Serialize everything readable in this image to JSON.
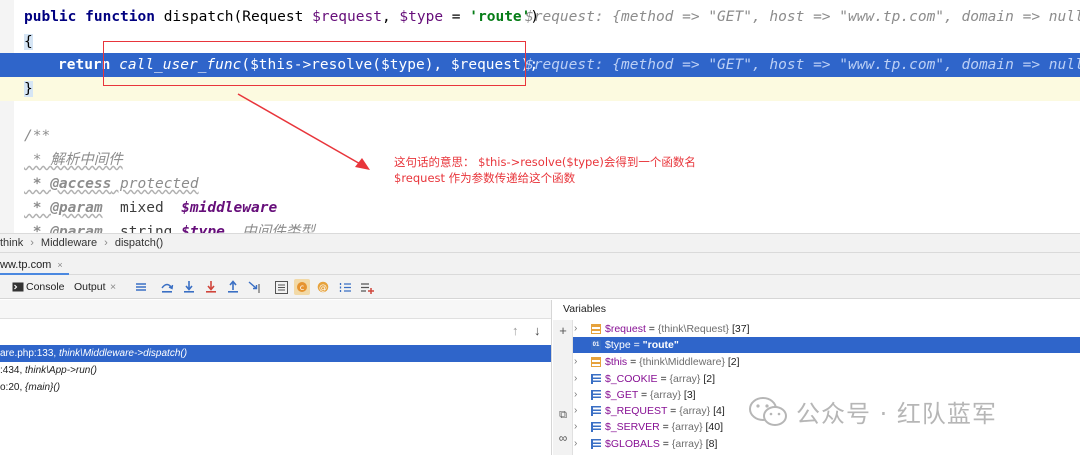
{
  "editor": {
    "line1": {
      "kw1": "public",
      "kw2": "function",
      "name": " dispatch(Request ",
      "param1": "$request",
      "sep": ", ",
      "param2": "$type",
      "eq": " = ",
      "default": "'route'",
      "close": ")",
      "hint": "$request: {method => \"GET\", host => \"www.tp.com\", domain => null, su"
    },
    "line2": {
      "brace": "{"
    },
    "line3": {
      "kw": "return",
      "fn": "call_user_func",
      "args_a": "($this->resolve(",
      "args_var": "$type",
      "args_b": "), ",
      "args_var2": "$request",
      "args_c": ");",
      "hint": "$request: {method => \"GET\", host => \"www.tp.com\", domain => null, su"
    },
    "line4": {
      "brace": "}"
    },
    "doc": {
      "open": "/**",
      "desc": " * 解析中间件",
      "access_tag": " * @access",
      "access_val": " protected",
      "param_tag": " * @param",
      "param_type": "  mixed  ",
      "param_var": "$middleware",
      "param2_tag": " * @param",
      "param2_type": "  string ",
      "param2_var": "$type",
      "param2_desc": "  中间件类型"
    },
    "annotation_line1": "这句话的意思：  $this->resolve($type)会得到一个函数名",
    "annotation_line2": "$request 作为参数传递给这个函数"
  },
  "breadcrumb": [
    "think",
    "Middleware",
    "dispatch()"
  ],
  "debug_session": {
    "label": "ww.tp.com",
    "close": "×"
  },
  "toolbar": {
    "console_label": "Console",
    "output_label": "Output",
    "output_close": "×"
  },
  "frames": [
    {
      "loc": "are.php:133, ",
      "method": "think\\Middleware->dispatch()"
    },
    {
      "loc": ":434, ",
      "method": "think\\App->run()"
    },
    {
      "loc": "o:20, ",
      "method": "{main}()"
    }
  ],
  "variables": {
    "title": "Variables",
    "items": [
      {
        "name": "$request",
        "eq": " = ",
        "type": "{think\\Request}",
        "value": " [37]",
        "icon": "object"
      },
      {
        "name": "$type",
        "eq": " = ",
        "type": "",
        "value": "\"route\"",
        "icon": "primitive"
      },
      {
        "name": "$this",
        "eq": " = ",
        "type": "{think\\Middleware}",
        "value": " [2]",
        "icon": "object"
      },
      {
        "name": "$_COOKIE",
        "eq": " = ",
        "type": "{array}",
        "value": " [2]",
        "icon": "array"
      },
      {
        "name": "$_GET",
        "eq": " = ",
        "type": "{array}",
        "value": " [3]",
        "icon": "array"
      },
      {
        "name": "$_REQUEST",
        "eq": " = ",
        "type": "{array}",
        "value": " [4]",
        "icon": "array"
      },
      {
        "name": "$_SERVER",
        "eq": " = ",
        "type": "{array}",
        "value": " [40]",
        "icon": "array"
      },
      {
        "name": "$GLOBALS",
        "eq": " = ",
        "type": "{array}",
        "value": " [8]",
        "icon": "array"
      }
    ]
  },
  "watermark": "公众号 · 红队蓝军",
  "colors": {
    "exec_line": "#2f65ca",
    "annotation": "#e8353b",
    "selected_row": "#2f65ca"
  }
}
